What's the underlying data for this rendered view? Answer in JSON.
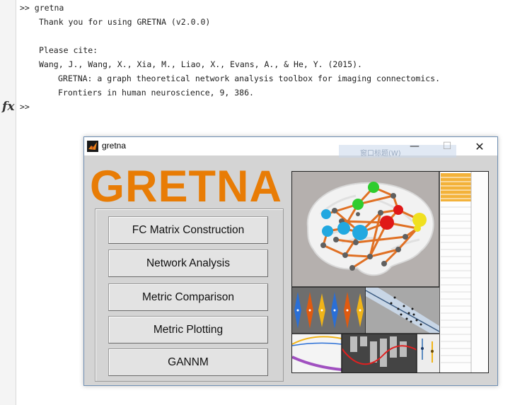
{
  "command_window": {
    "lines": [
      ">> gretna",
      "Thank you for using GRETNA (v2.0.0)",
      "Please cite:",
      "Wang, J., Wang, X., Xia, M., Liao, X., Evans, A., & He, Y. (2015).",
      "GRETNA: a graph theoretical network analysis toolbox for imaging connectomics.",
      "Frontiers in human neuroscience, 9, 386."
    ],
    "prompt": ">>",
    "fx_label": "fx"
  },
  "gretna_window": {
    "title": "gretna",
    "ghost_menu": "窗口标题(W)",
    "controls": {
      "minimize": "—",
      "maximize": "☐",
      "close": "✕"
    },
    "logo_text": "GRETNA",
    "buttons": [
      "FC Matrix Construction",
      "Network Analysis",
      "Metric Comparison",
      "Metric Plotting",
      "GANNM"
    ]
  },
  "colors": {
    "logo": "#e87c05",
    "edge": "#e06a1a",
    "node_cyan": "#22a8e0",
    "node_green": "#2ecc2e",
    "node_red": "#e01818",
    "node_yellow": "#f0e020"
  },
  "icons": [
    "matlab-icon",
    "minimize-icon",
    "maximize-icon",
    "close-icon"
  ]
}
